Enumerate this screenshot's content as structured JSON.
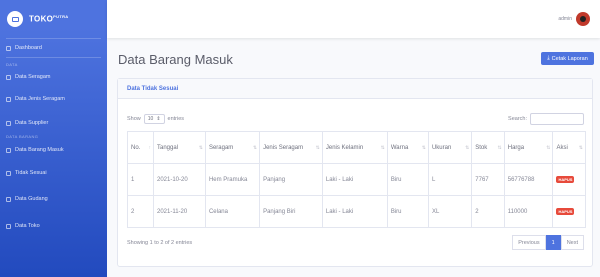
{
  "brand": {
    "name": "TOKO",
    "sup": "PUTRA"
  },
  "sidebar": {
    "items": [
      {
        "label": "Dashboard"
      },
      {
        "label": "Data Seragam"
      },
      {
        "label": "Data Jenis Seragam"
      },
      {
        "label": "Data Supplier"
      },
      {
        "label": "Data Barang Masuk"
      },
      {
        "label": "Tidak Sesuai"
      },
      {
        "label": "Data Gudang"
      },
      {
        "label": "Data Toko"
      }
    ],
    "heading_1": "DATA",
    "heading_2": "DATA BARANG"
  },
  "topbar": {
    "user": "admin"
  },
  "page": {
    "title": "Data Barang Masuk",
    "cetak_label": "Cetak Laporan"
  },
  "card": {
    "header": "Data Tidak Sesuai"
  },
  "controls": {
    "show": "Show",
    "entries": "entries",
    "length": "10",
    "search_label": "Search:"
  },
  "table": {
    "columns": [
      "No.",
      "Tanggal",
      "Seragam",
      "Jenis Seragam",
      "Jenis Kelamin",
      "Warna",
      "Ukuran",
      "Stok",
      "Harga",
      "Aksi"
    ],
    "rows": [
      {
        "no": "1",
        "tanggal": "2021-10-20",
        "seragam": "Hem Pramuka",
        "jenis": "Panjang",
        "kelamin": "Laki - Laki",
        "warna": "Biru",
        "ukuran": "L",
        "stok": "7767",
        "harga": "56776788",
        "aksi": "HAPUS"
      },
      {
        "no": "2",
        "tanggal": "2021-11-20",
        "seragam": "Celana",
        "jenis": "Panjang Biri",
        "kelamin": "Laki - Laki",
        "warna": "Biru",
        "ukuran": "XL",
        "stok": "2",
        "harga": "110000",
        "aksi": "HAPUS"
      }
    ]
  },
  "footer": {
    "info": "Showing 1 to 2 of 2 entries",
    "prev": "Previous",
    "page": "1",
    "next": "Next"
  }
}
